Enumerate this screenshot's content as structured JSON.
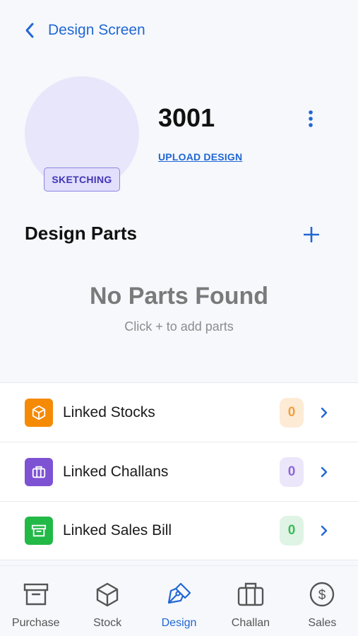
{
  "header": {
    "title": "Design Screen"
  },
  "design": {
    "number": "3001",
    "status": "SKETCHING",
    "upload_label": "UPLOAD DESIGN"
  },
  "parts": {
    "title": "Design Parts",
    "empty_title": "No Parts Found",
    "empty_hint": "Click + to add parts"
  },
  "links": [
    {
      "label": "Linked Stocks",
      "count": "0",
      "icon": "cube-icon",
      "color": "#f58a07",
      "badge_bg": "#fdebd6",
      "badge_fg": "#f0a040"
    },
    {
      "label": "Linked Challans",
      "count": "0",
      "icon": "briefcase-icon",
      "color": "#7d52d3",
      "badge_bg": "#ece6fa",
      "badge_fg": "#8a68d8"
    },
    {
      "label": "Linked Sales Bill",
      "count": "0",
      "icon": "archive-icon",
      "color": "#22b947",
      "badge_bg": "#e0f4e5",
      "badge_fg": "#3cbb5a"
    }
  ],
  "nav": {
    "active": "Design",
    "items": [
      {
        "label": "Purchase",
        "icon": "archive-icon"
      },
      {
        "label": "Stock",
        "icon": "cube-icon"
      },
      {
        "label": "Design",
        "icon": "pen-tool-icon"
      },
      {
        "label": "Challan",
        "icon": "briefcase-icon"
      },
      {
        "label": "Sales",
        "icon": "dollar-circle-icon"
      }
    ]
  },
  "colors": {
    "accent": "#2167d3",
    "background": "#f6f8fc",
    "nav_inactive": "#555555"
  }
}
